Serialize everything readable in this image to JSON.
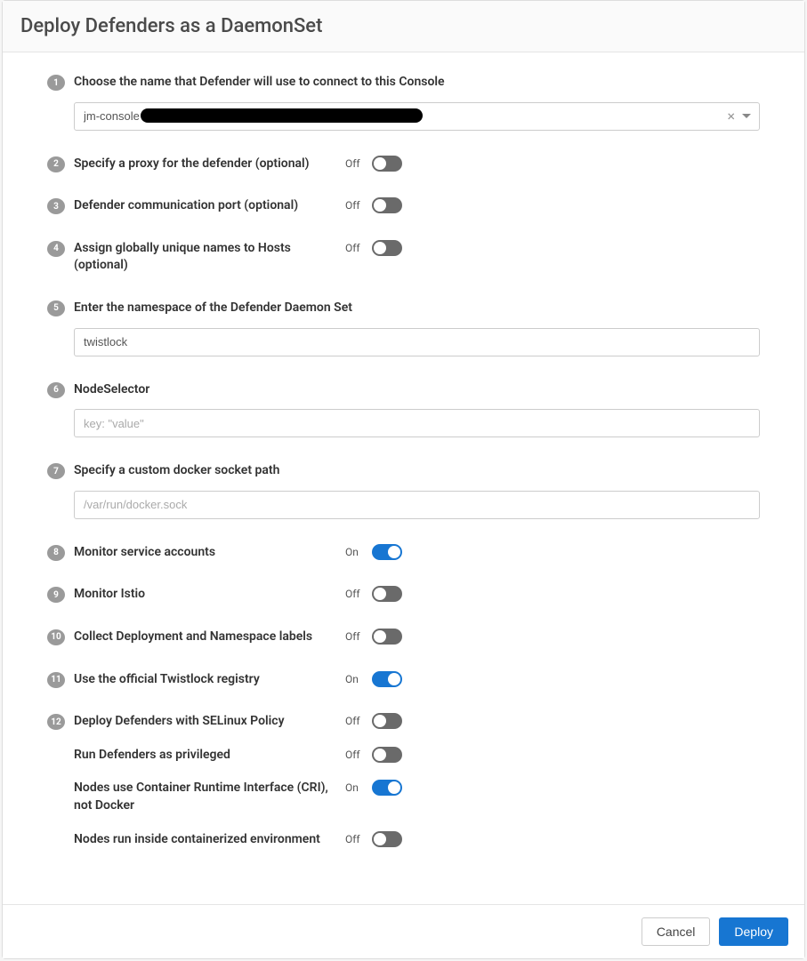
{
  "title": "Deploy Defenders as a DaemonSet",
  "onLabel": "On",
  "offLabel": "Off",
  "steps": {
    "console": {
      "num": "1",
      "label": "Choose the name that Defender will use to connect to this Console",
      "value": "jm-console"
    },
    "proxy": {
      "num": "2",
      "label": "Specify a proxy for the defender (optional)",
      "state": "Off"
    },
    "port": {
      "num": "3",
      "label": "Defender communication port (optional)",
      "state": "Off"
    },
    "uniquehosts": {
      "num": "4",
      "label": "Assign globally unique names to Hosts (optional)",
      "state": "Off"
    },
    "namespace": {
      "num": "5",
      "label": "Enter the namespace of the Defender Daemon Set",
      "value": "twistlock"
    },
    "nodeselector": {
      "num": "6",
      "label": "NodeSelector",
      "placeholder": "key: \"value\""
    },
    "docker": {
      "num": "7",
      "label": "Specify a custom docker socket path",
      "placeholder": "/var/run/docker.sock"
    },
    "serviceaccounts": {
      "num": "8",
      "label": "Monitor service accounts",
      "state": "On"
    },
    "istio": {
      "num": "9",
      "label": "Monitor Istio",
      "state": "Off"
    },
    "labels": {
      "num": "10",
      "label": "Collect Deployment and Namespace labels",
      "state": "Off"
    },
    "registry": {
      "num": "11",
      "label": "Use the official Twistlock registry",
      "state": "On"
    },
    "selinux": {
      "num": "12",
      "label": "Deploy Defenders with SELinux Policy",
      "state": "Off",
      "sub": {
        "privileged": {
          "label": "Run Defenders as privileged",
          "state": "Off"
        },
        "cri": {
          "label": "Nodes use Container Runtime Interface (CRI), not Docker",
          "state": "On"
        },
        "containerized": {
          "label": "Nodes run inside containerized environment",
          "state": "Off"
        }
      }
    }
  },
  "footer": {
    "cancel": "Cancel",
    "deploy": "Deploy"
  }
}
